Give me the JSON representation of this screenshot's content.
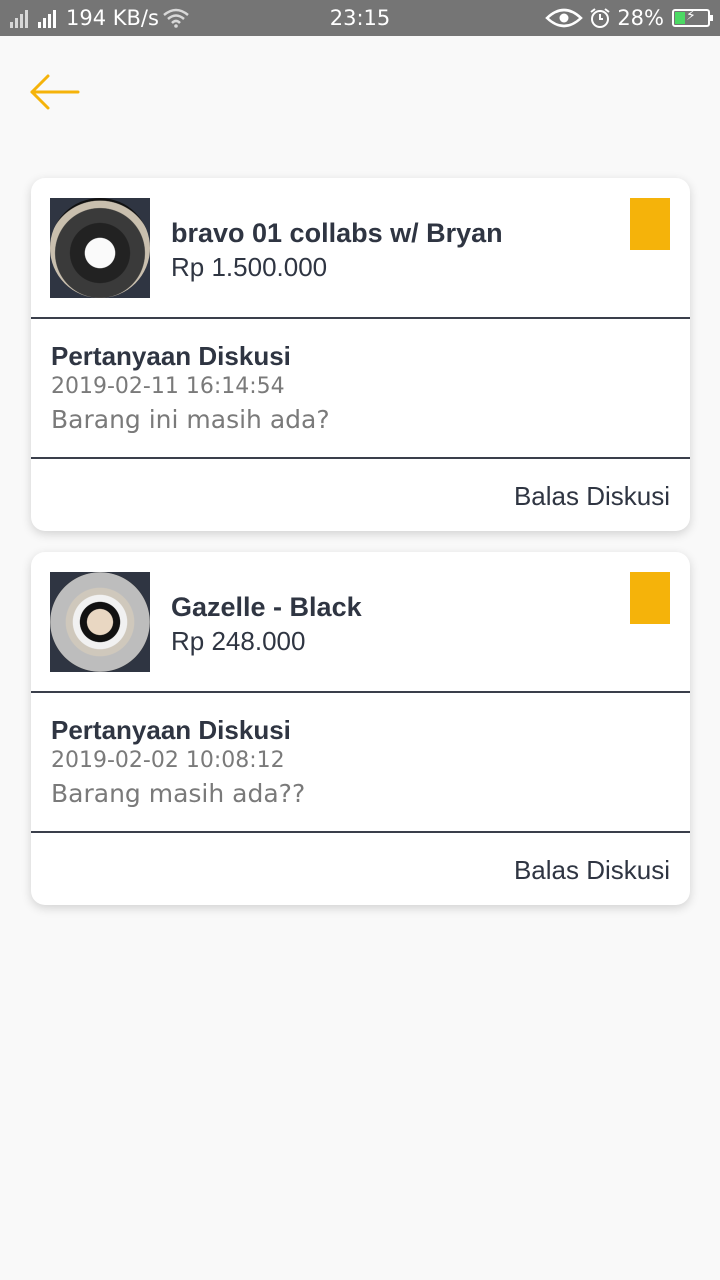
{
  "status_bar": {
    "network_speed": "194 KB/s",
    "time": "23:15",
    "battery": "28%",
    "icons": [
      "signal-icon",
      "wifi-icon",
      "eye-icon",
      "alarm-icon",
      "battery-charging-icon"
    ]
  },
  "header": {
    "back_icon": "arrow-left-icon",
    "accent_color": "#f5b30a"
  },
  "discussions": [
    {
      "product_name": "bravo 01 collabs w/ Bryan",
      "product_price": "Rp 1.500.000",
      "question_title": "Pertanyaan Diskusi",
      "question_date": "2019-02-11 16:14:54",
      "question_text": "Barang ini masih ada?",
      "reply_label": "Balas Diskusi"
    },
    {
      "product_name": "Gazelle - Black",
      "product_price": "Rp 248.000",
      "question_title": "Pertanyaan Diskusi",
      "question_date": "2019-02-02 10:08:12",
      "question_text": "Barang masih ada??",
      "reply_label": "Balas Diskusi"
    }
  ]
}
